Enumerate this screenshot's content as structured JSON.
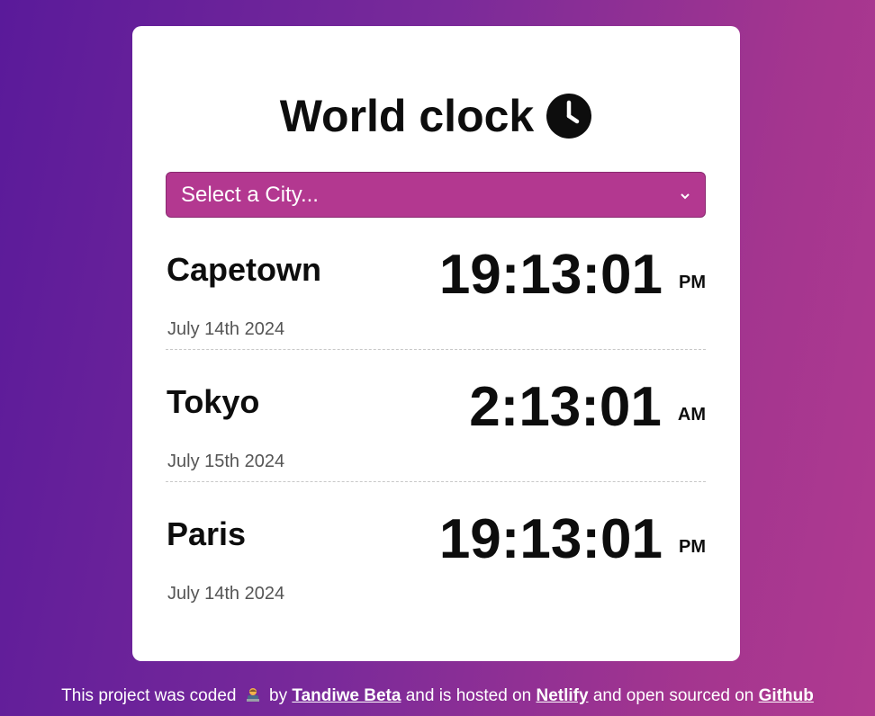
{
  "header": {
    "title": "World clock",
    "icon": "clock-icon"
  },
  "city_select": {
    "placeholder": "Select a City...",
    "icon": "chevron-down-icon"
  },
  "cities": [
    {
      "name": "Capetown",
      "date": "July 14th 2024",
      "time": "19:13:01",
      "ampm": "PM"
    },
    {
      "name": "Tokyo",
      "date": "July 15th 2024",
      "time": "2:13:01",
      "ampm": "AM"
    },
    {
      "name": "Paris",
      "date": "July 14th 2024",
      "time": "19:13:01",
      "ampm": "PM"
    }
  ],
  "footer": {
    "text_1": "This project was coded",
    "emoji": "technologist-emoji",
    "text_2": "by",
    "author_link": "Tandiwe Beta",
    "text_3": "and is hosted on",
    "host_link": "Netlify",
    "text_4": "and open sourced on",
    "source_link": "Github"
  },
  "colors": {
    "select_background": "#b33890",
    "background_start": "#5a1a9a",
    "background_end": "#b03a90"
  }
}
